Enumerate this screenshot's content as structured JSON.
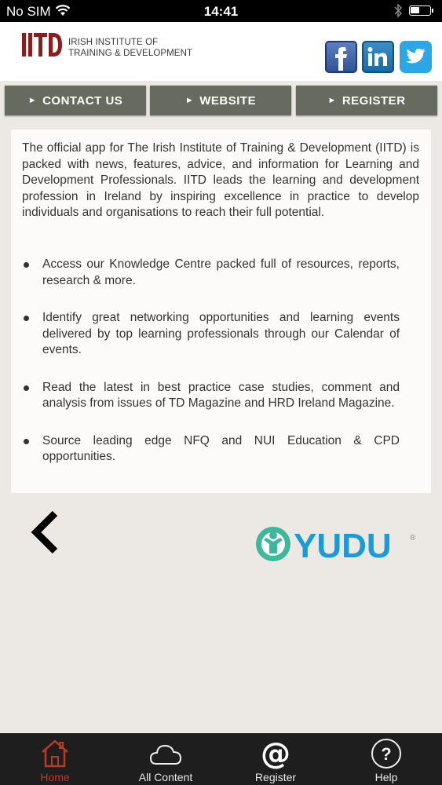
{
  "status_bar": {
    "carrier": "No SIM",
    "time": "14:41"
  },
  "header": {
    "logo_text_line1": "IRISH INSTITUTE OF",
    "logo_text_line2": "TRAINING & DEVELOPMENT",
    "social": [
      "facebook",
      "linkedin",
      "twitter"
    ]
  },
  "nav_buttons": [
    {
      "label": "CONTACT US"
    },
    {
      "label": "WEBSITE"
    },
    {
      "label": "REGISTER"
    }
  ],
  "content": {
    "intro": "The official app for The Irish Institute of Training & Development (IITD) is packed with news, features, advice, and information for Learning and Development Professionals. IITD leads the learning and development profession in Ireland by inspiring excellence in practice to develop individuals and organisations to reach their full potential.",
    "bullets": [
      "Access our Knowledge Centre packed full of resources, reports, research & more.",
      "Identify great networking opportunities and learning events delivered by top learning professionals through our Calendar of events.",
      "Read the latest in best practice case studies, comment and analysis from issues of TD Magazine and HRD Ireland Magazine.",
      "Source leading edge NFQ and NUI Education & CPD opportunities."
    ]
  },
  "footer_logo": {
    "text": "YUDU",
    "mark": "®"
  },
  "tab_bar": {
    "tabs": [
      {
        "label": "Home",
        "icon": "house-icon",
        "active": true
      },
      {
        "label": "All Content",
        "icon": "cloud-icon",
        "active": false
      },
      {
        "label": "Register",
        "icon": "at-sign-icon",
        "active": false
      },
      {
        "label": "Help",
        "icon": "question-icon",
        "active": false
      }
    ]
  },
  "colors": {
    "brand": "#8b1d1d",
    "nav_button": "#676a5e",
    "active_tab": "#b83a24",
    "yudu_teal": "#3db89c",
    "yudu_blue": "#1a9bd7"
  }
}
